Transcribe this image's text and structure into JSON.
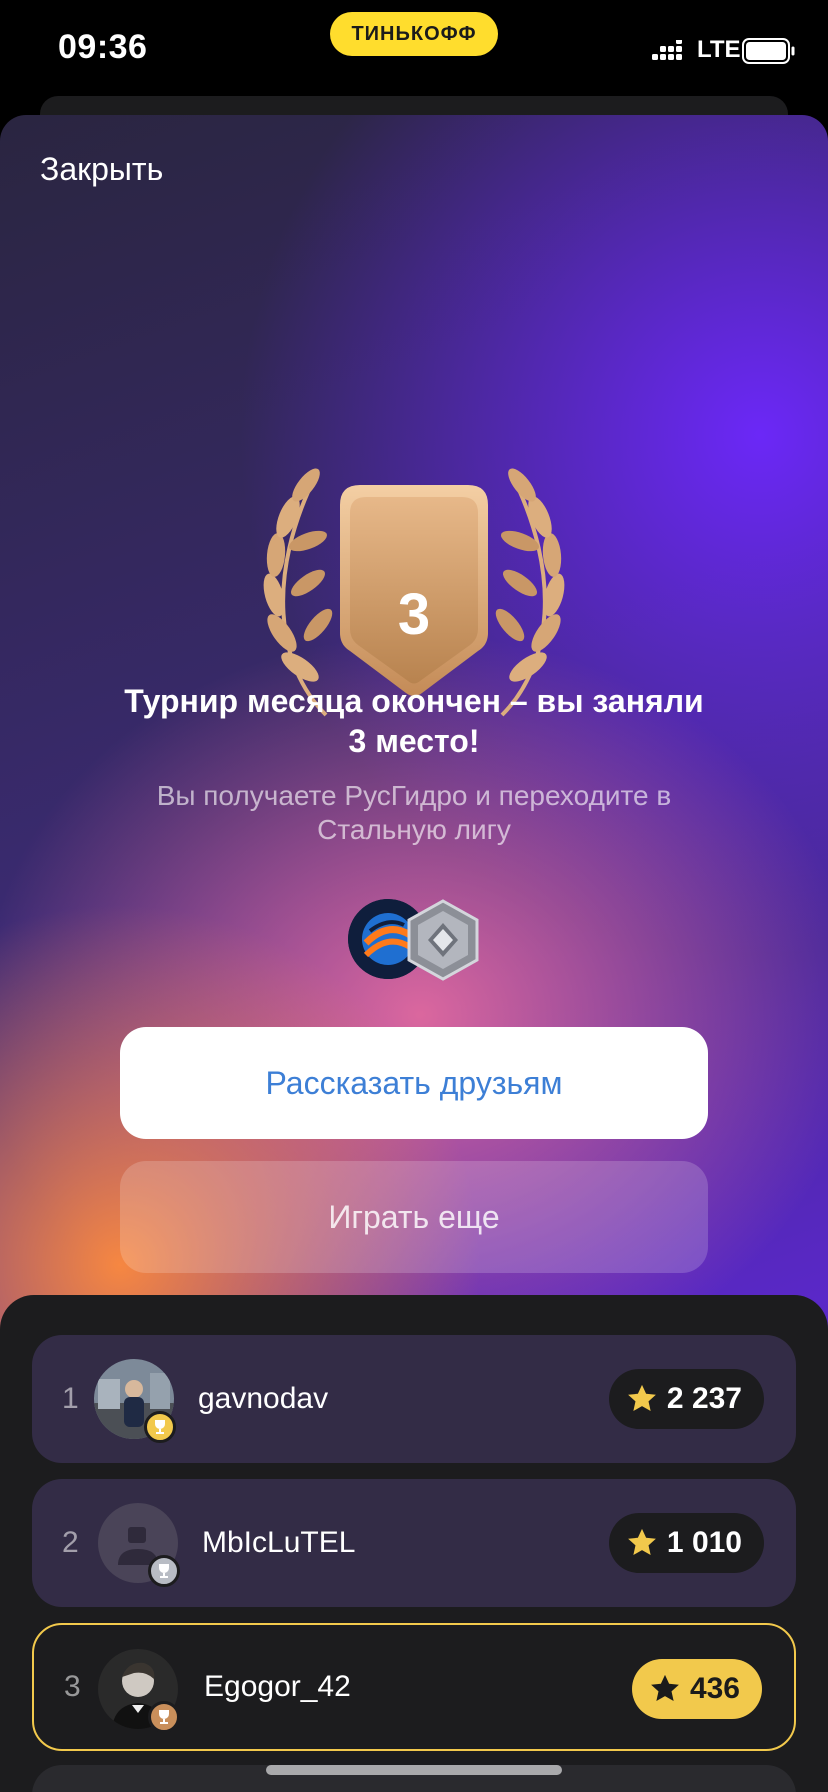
{
  "status_bar": {
    "time": "09:36",
    "brand": "ТИНЬКОФФ",
    "network": "LTE"
  },
  "modal": {
    "close_label": "Закрыть",
    "place": "3",
    "headline": "Турнир месяца окончен – вы заняли 3 место!",
    "subtext": "Вы получаете РусГидро и переходите в Стальную лигу",
    "rewards": [
      "rushydro-stock-icon",
      "steel-league-icon"
    ],
    "share_label": "Рассказать друзьям",
    "play_label": "Играть еще"
  },
  "leaderboard": {
    "rows": [
      {
        "rank": "1",
        "name": "gavnodav",
        "score": "2 237",
        "cup": "gold"
      },
      {
        "rank": "2",
        "name": "MbIcLuTEL",
        "score": "1 010",
        "cup": "silver"
      },
      {
        "rank": "3",
        "name": "Egogor_42",
        "score": "436",
        "cup": "bronze",
        "is_current_user": true
      }
    ]
  },
  "colors": {
    "brand_yellow": "#ffdd2d",
    "accent_blue": "#3d7fd6",
    "highlight_gold": "#f2c94c",
    "row_bg": "#332c46",
    "sheet_bg": "#1c1c1e"
  }
}
